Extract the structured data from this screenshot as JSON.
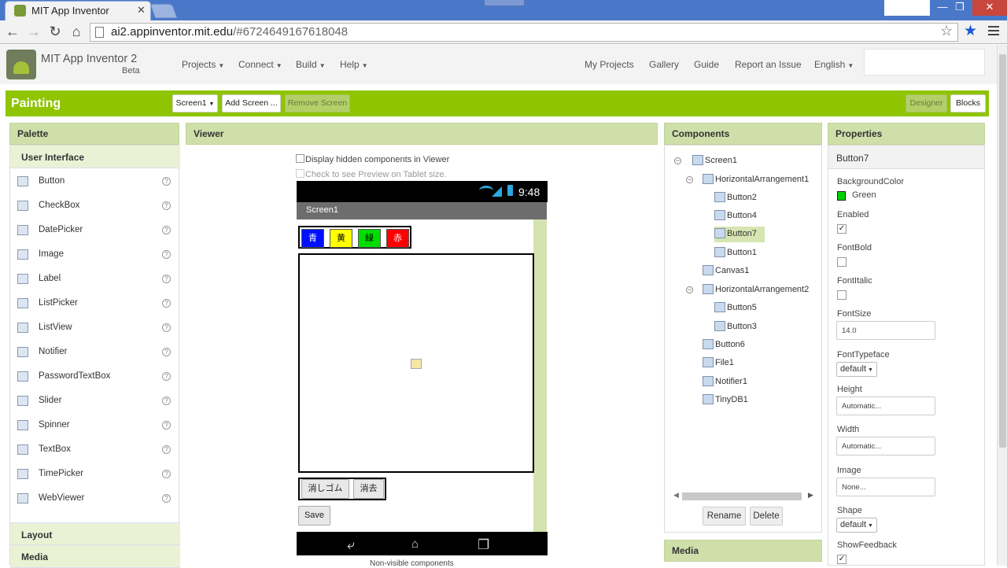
{
  "browser": {
    "tab_title": "MIT App Inventor",
    "tab_close": "✕",
    "url_host": "ai2.appinventor.mit.edu",
    "url_hash": "/#6724649167618048"
  },
  "header": {
    "brand": "MIT App Inventor 2",
    "beta": "Beta",
    "nav": [
      {
        "label": "Projects"
      },
      {
        "label": "Connect"
      },
      {
        "label": "Build"
      },
      {
        "label": "Help"
      }
    ],
    "right_nav": [
      "My Projects",
      "Gallery",
      "Guide",
      "Report an Issue",
      "English"
    ]
  },
  "project_bar": {
    "title": "Painting",
    "screen_select": "Screen1",
    "add_screen": "Add Screen ...",
    "remove_screen": "Remove Screen",
    "designer": "Designer",
    "blocks": "Blocks"
  },
  "palette": {
    "title": "Palette",
    "section": "User Interface",
    "items": [
      "Button",
      "CheckBox",
      "DatePicker",
      "Image",
      "Label",
      "ListPicker",
      "ListView",
      "Notifier",
      "PasswordTextBox",
      "Slider",
      "Spinner",
      "TextBox",
      "TimePicker",
      "WebViewer"
    ],
    "help_glyph": "?",
    "sections_after": [
      "Layout",
      "Media"
    ]
  },
  "viewer": {
    "title": "Viewer",
    "chk_hidden": "Display hidden components in Viewer",
    "chk_tablet": "Check to see Preview on Tablet size.",
    "time": "9:48",
    "screen_title": "Screen1",
    "color_buttons": [
      {
        "label": "青",
        "color": "#0010ff",
        "fg": "#ffffff"
      },
      {
        "label": "黄",
        "color": "#ffff00",
        "fg": "#000000"
      },
      {
        "label": "緑",
        "color": "#00dd00",
        "fg": "#000000"
      },
      {
        "label": "赤",
        "color": "#ff0000",
        "fg": "#ffffff"
      }
    ],
    "eraser": "消しゴム",
    "clear": "消去",
    "save": "Save",
    "nonvisible": "Non-visible components"
  },
  "components": {
    "title": "Components",
    "tree": [
      {
        "label": "Screen1",
        "level": 0,
        "toggle": "−"
      },
      {
        "label": "HorizontalArrangement1",
        "level": 1,
        "toggle": "−"
      },
      {
        "label": "Button2",
        "level": 2
      },
      {
        "label": "Button4",
        "level": 2
      },
      {
        "label": "Button7",
        "level": 2,
        "selected": true
      },
      {
        "label": "Button1",
        "level": 2
      },
      {
        "label": "Canvas1",
        "level": 1
      },
      {
        "label": "HorizontalArrangement2",
        "level": 1,
        "toggle": "−"
      },
      {
        "label": "Button5",
        "level": 2
      },
      {
        "label": "Button3",
        "level": 2
      },
      {
        "label": "Button6",
        "level": 1
      },
      {
        "label": "File1",
        "level": 1
      },
      {
        "label": "Notifier1",
        "level": 1
      },
      {
        "label": "TinyDB1",
        "level": 1
      }
    ],
    "rename": "Rename",
    "delete": "Delete",
    "media": "Media"
  },
  "properties": {
    "title": "Properties",
    "component": "Button7",
    "background_color_label": "BackgroundColor",
    "background_color_value": "Green",
    "background_color_hex": "#00d000",
    "enabled_label": "Enabled",
    "fontbold_label": "FontBold",
    "fontitalic_label": "FontItalic",
    "fontsize_label": "FontSize",
    "fontsize_value": "14.0",
    "fonttypeface_label": "FontTypeface",
    "fonttypeface_value": "default",
    "height_label": "Height",
    "height_value": "Automatic...",
    "width_label": "Width",
    "width_value": "Automatic...",
    "image_label": "Image",
    "image_value": "None...",
    "shape_label": "Shape",
    "shape_value": "default",
    "showfeedback_label": "ShowFeedback",
    "check_glyph": "✓"
  }
}
